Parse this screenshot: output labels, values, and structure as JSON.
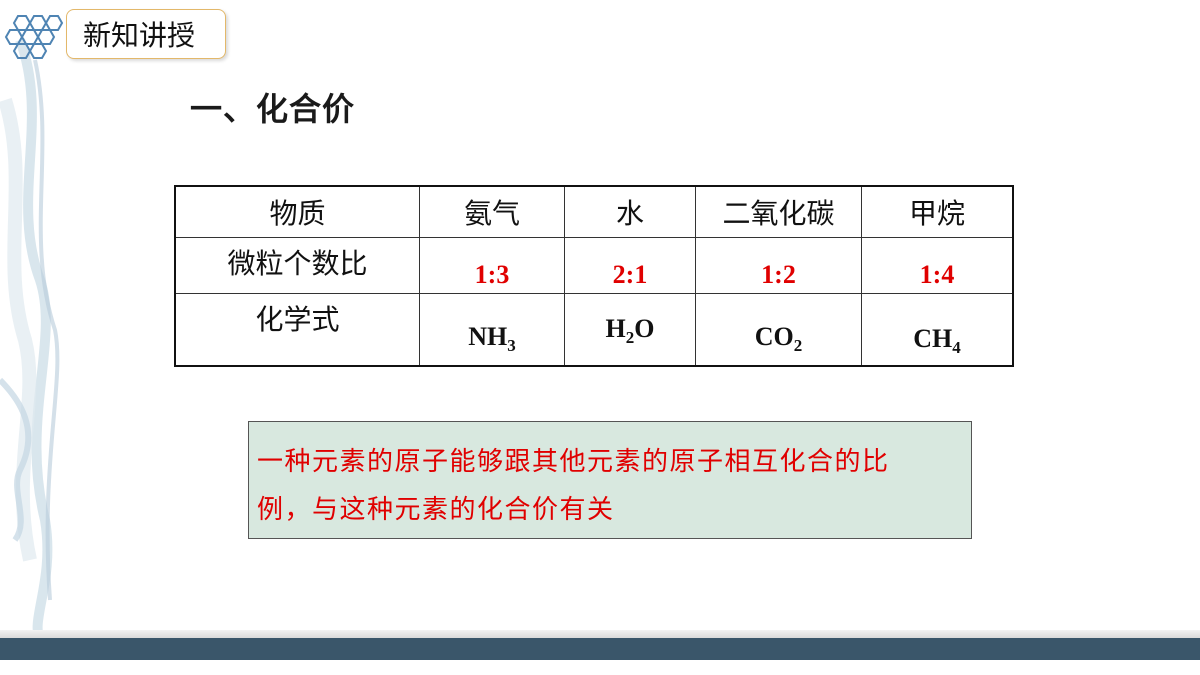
{
  "header": {
    "section_tag": "新知讲授",
    "title": "一、化合价"
  },
  "table": {
    "columns": [
      "物质",
      "氨气",
      "水",
      "二氧化碳",
      "甲烷"
    ],
    "ratio_row": {
      "label": "微粒个数比",
      "values": [
        "1:3",
        "2:1",
        "1:2",
        "1:4"
      ]
    },
    "formula_row": {
      "label": "化学式",
      "formulas": [
        {
          "base": "NH",
          "sub": "3",
          "post": ""
        },
        {
          "base": "H",
          "sub": "2",
          "post": "O"
        },
        {
          "base": "CO",
          "sub": "2",
          "post": ""
        },
        {
          "base": "CH",
          "sub": "4",
          "post": ""
        }
      ]
    }
  },
  "note": {
    "line1": "一种元素的原子能够跟其他元素的原子相互化合的比",
    "line2": "例，与这种元素的化合价有关"
  },
  "colors": {
    "accent_red": "#e00000",
    "note_bg": "#d8e8df",
    "footer": "#3a566a",
    "tag_border": "#e3b86a"
  }
}
